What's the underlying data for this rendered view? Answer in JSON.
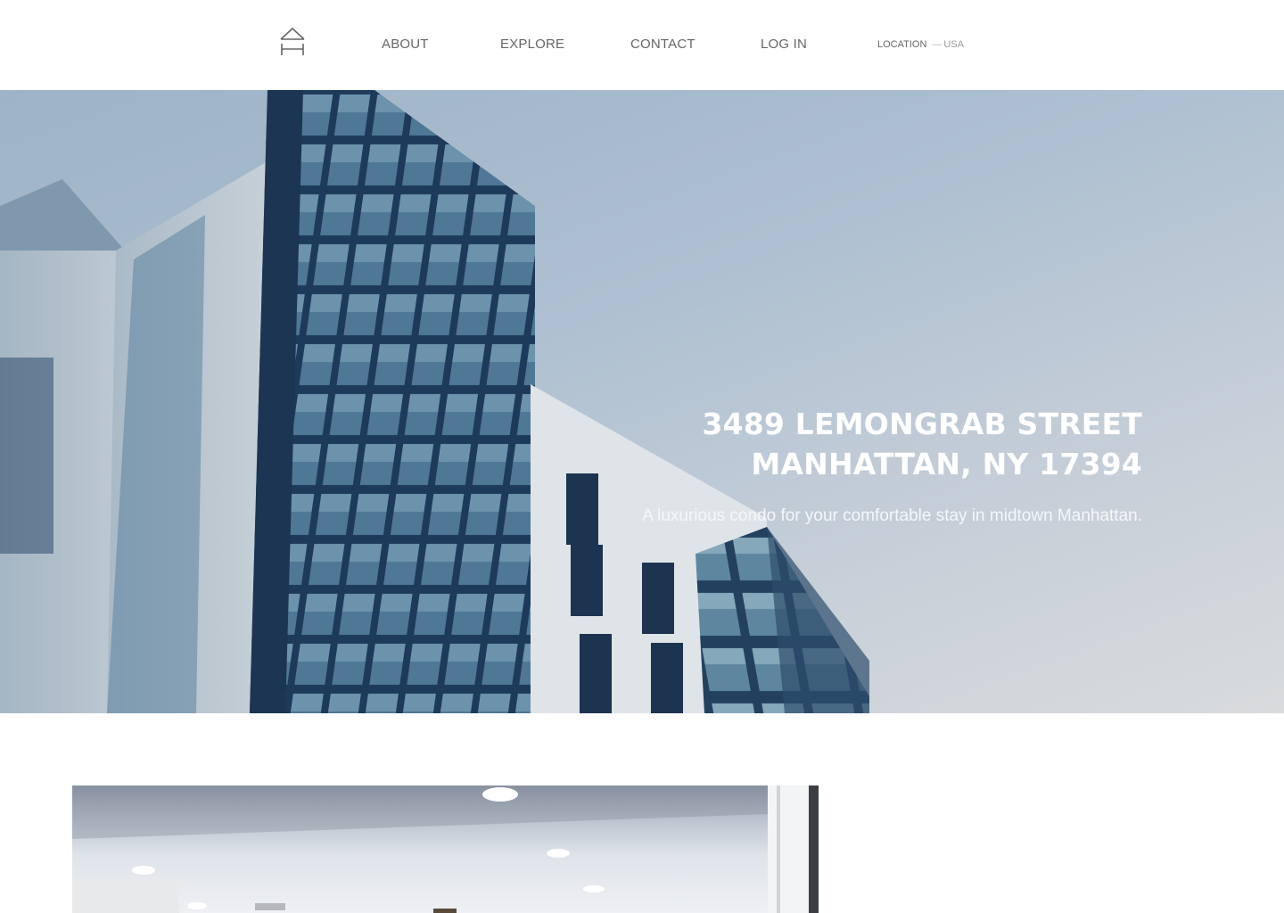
{
  "nav": {
    "logo_icon": "house-icon",
    "links": [
      {
        "label": "ABOUT"
      },
      {
        "label": "EXPLORE"
      },
      {
        "label": "CONTACT"
      },
      {
        "label": "LOG IN"
      }
    ],
    "location": {
      "label": "LOCATION",
      "separator": "—",
      "value": "USA"
    }
  },
  "hero": {
    "title_line1": "3489 LEMONGRAB STREET",
    "title_line2": "MANHATTAN, NY 17394",
    "subtitle": "A luxurious condo for your comfortable stay in midtown Manhattan."
  },
  "colors": {
    "nav_text": "#666666",
    "hero_text": "#ffffff",
    "sky": "#aec0d1",
    "building_glass": "#1f3f63"
  }
}
